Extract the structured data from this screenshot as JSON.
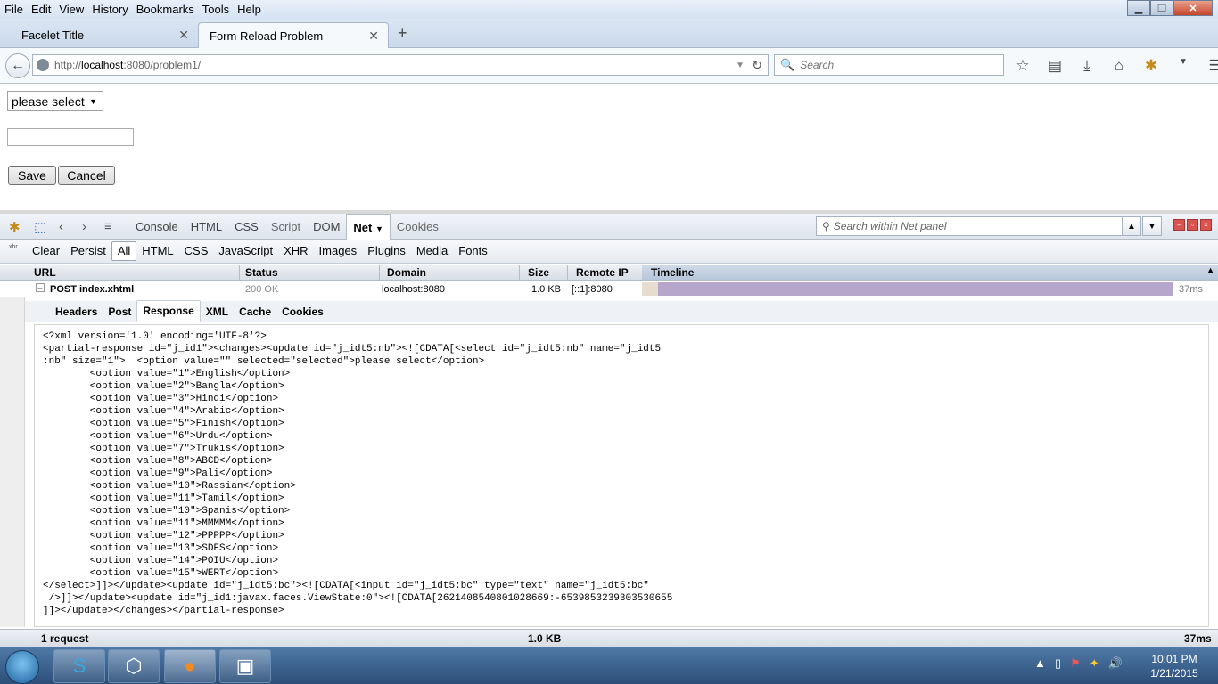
{
  "menu": [
    "File",
    "Edit",
    "View",
    "History",
    "Bookmarks",
    "Tools",
    "Help"
  ],
  "tabs": [
    {
      "title": "Facelet Title"
    },
    {
      "title": "Form Reload Problem"
    }
  ],
  "url": {
    "prefix": "http://",
    "host": "localhost",
    "rest": ":8080/problem1/"
  },
  "search_placeholder": "Search",
  "page": {
    "select_value": "please select",
    "save_label": "Save",
    "cancel_label": "Cancel"
  },
  "firebug": {
    "tabs": [
      "Console",
      "HTML",
      "CSS",
      "Script",
      "DOM",
      "Net",
      "Cookies"
    ],
    "active_tab": "Net",
    "search_placeholder": "Search within Net panel",
    "filters": [
      "Clear",
      "Persist",
      "All",
      "HTML",
      "CSS",
      "JavaScript",
      "XHR",
      "Images",
      "Plugins",
      "Media",
      "Fonts"
    ],
    "xhr_label": "xhr",
    "columns": {
      "url": "URL",
      "status": "Status",
      "domain": "Domain",
      "size": "Size",
      "remote_ip": "Remote IP",
      "timeline": "Timeline"
    },
    "request": {
      "url": "POST index.xhtml",
      "status": "200 OK",
      "domain": "localhost:8080",
      "size": "1.0 KB",
      "remote_ip": "[::1]:8080",
      "time": "37ms"
    },
    "detail_tabs": [
      "Headers",
      "Post",
      "Response",
      "XML",
      "Cache",
      "Cookies"
    ],
    "active_detail_tab": "Response",
    "response_lines": [
      "<?xml version='1.0' encoding='UTF-8'?>",
      "<partial-response id=\"j_id1\"><changes><update id=\"j_idt5:nb\"><![CDATA[<select id=\"j_idt5:nb\" name=\"j_idt5",
      ":nb\" size=\"1\">  <option value=\"\" selected=\"selected\">please select</option>",
      "        <option value=\"1\">English</option>",
      "        <option value=\"2\">Bangla</option>",
      "        <option value=\"3\">Hindi</option>",
      "        <option value=\"4\">Arabic</option>",
      "        <option value=\"5\">Finish</option>",
      "        <option value=\"6\">Urdu</option>",
      "        <option value=\"7\">Trukis</option>",
      "        <option value=\"8\">ABCD</option>",
      "        <option value=\"9\">Pali</option>",
      "        <option value=\"10\">Rassian</option>",
      "        <option value=\"11\">Tamil</option>",
      "        <option value=\"10\">Spanis</option>",
      "        <option value=\"11\">MMMMM</option>",
      "        <option value=\"12\">PPPPP</option>",
      "        <option value=\"13\">SDFS</option>",
      "        <option value=\"14\">POIU</option>",
      "        <option value=\"15\">WERT</option>",
      "</select>]]></update><update id=\"j_idt5:bc\"><![CDATA[<input id=\"j_idt5:bc\" type=\"text\" name=\"j_idt5:bc\"",
      " />]]></update><update id=\"j_id1:javax.faces.ViewState:0\"><![CDATA[2621408540801028669:-6539853239303530655",
      "]]></update></changes></partial-response>"
    ],
    "status_bar": {
      "requests": "1 request",
      "size": "1.0 KB",
      "time": "37ms"
    }
  },
  "taskbar": {
    "time": "10:01 PM",
    "date": "1/21/2015"
  }
}
